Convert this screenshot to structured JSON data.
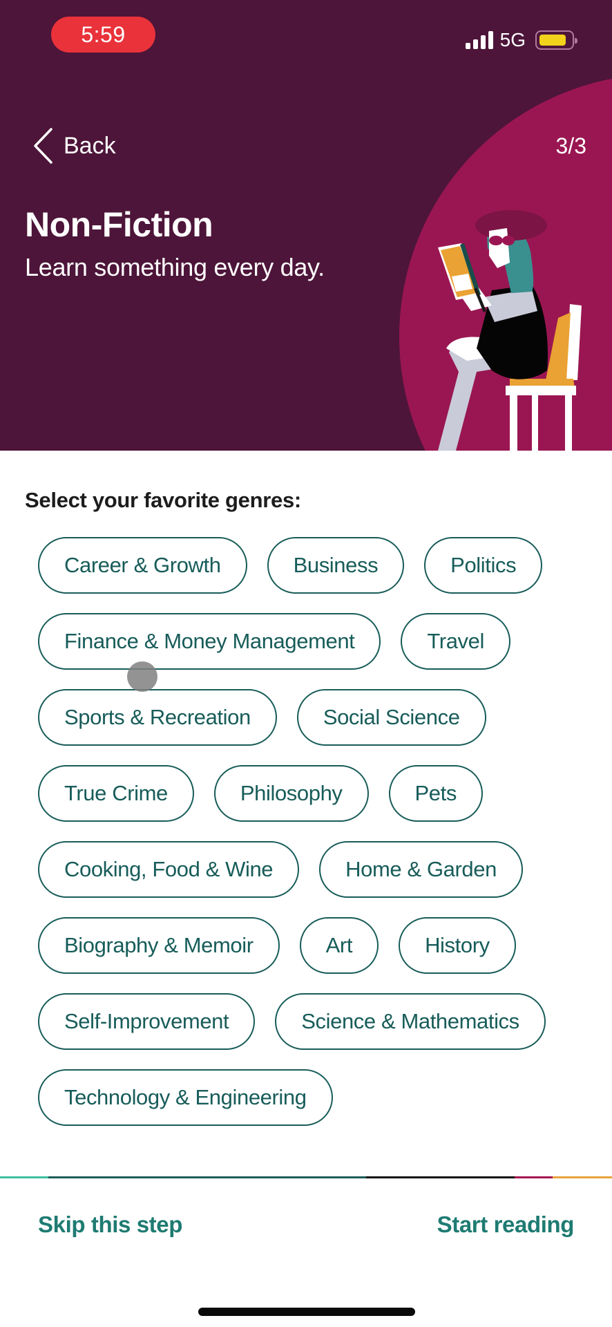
{
  "status_bar": {
    "time": "5:59",
    "network": "5G",
    "signal_bars": 4,
    "battery_level": 0.7,
    "colors": {
      "time_pill": "#e9323a",
      "battery": "#f2d21b"
    }
  },
  "header": {
    "back_label": "Back",
    "step_indicator": "3/3",
    "title": "Non-Fiction",
    "subtitle": "Learn something every day.",
    "colors": {
      "background": "#4d1539",
      "circle": "#9a1652"
    },
    "illustration": "woman-reading-book-on-chair"
  },
  "genres": {
    "label": "Select your favorite genres:",
    "items": [
      {
        "label": "Career & Growth",
        "selected": false
      },
      {
        "label": "Business",
        "selected": false
      },
      {
        "label": "Politics",
        "selected": false
      },
      {
        "label": "Finance & Money Management",
        "selected": false
      },
      {
        "label": "Travel",
        "selected": false
      },
      {
        "label": "Sports & Recreation",
        "selected": false
      },
      {
        "label": "Social Science",
        "selected": false
      },
      {
        "label": "True Crime",
        "selected": false
      },
      {
        "label": "Philosophy",
        "selected": false
      },
      {
        "label": "Pets",
        "selected": false
      },
      {
        "label": "Cooking, Food & Wine",
        "selected": false
      },
      {
        "label": "Home & Garden",
        "selected": false
      },
      {
        "label": "Biography & Memoir",
        "selected": false
      },
      {
        "label": "Art",
        "selected": false
      },
      {
        "label": "History",
        "selected": false
      },
      {
        "label": "Self-Improvement",
        "selected": false
      },
      {
        "label": "Science & Mathematics",
        "selected": false
      },
      {
        "label": "Technology & Engineering",
        "selected": false
      }
    ],
    "colors": {
      "chip_border": "#175c59",
      "chip_text": "#175c59"
    }
  },
  "footer": {
    "skip_label": "Skip this step",
    "start_label": "Start reading",
    "colors": {
      "action": "#1e7b72"
    }
  }
}
